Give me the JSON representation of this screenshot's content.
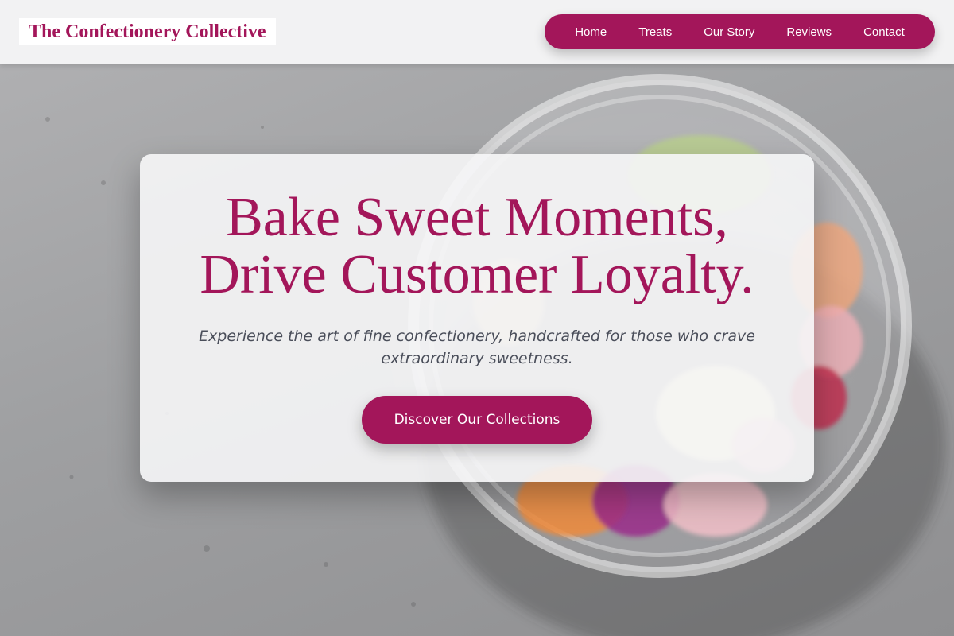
{
  "brand": {
    "name": "The Confectionery Collective",
    "color": "#a3165a"
  },
  "nav": {
    "items": [
      {
        "label": "Home"
      },
      {
        "label": "Treats"
      },
      {
        "label": "Our Story"
      },
      {
        "label": "Reviews"
      },
      {
        "label": "Contact"
      }
    ]
  },
  "hero": {
    "background": "candy-jar-photo",
    "title_line1": "Bake Sweet Moments,",
    "title_line2": "Drive Customer Loyalty.",
    "subtitle": "Experience the art of fine confectionery, handcrafted for those who crave extraordinary sweetness.",
    "cta_label": "Discover Our Collections"
  }
}
